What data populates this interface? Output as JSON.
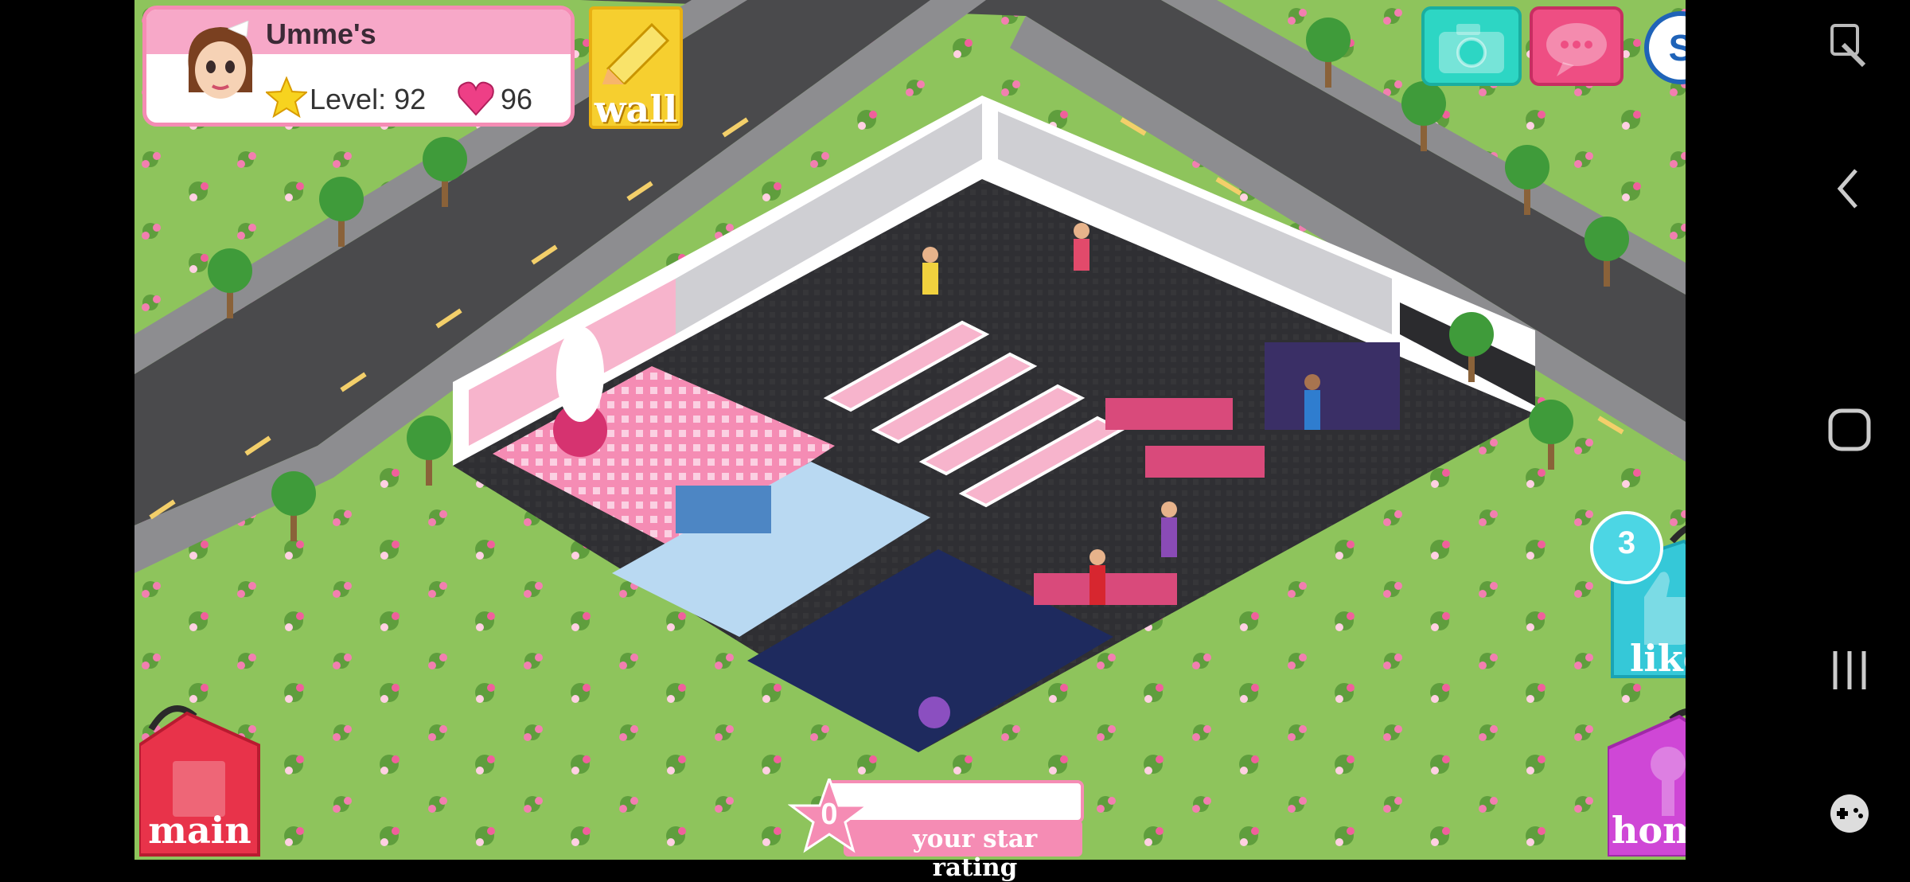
{
  "profile": {
    "name": "Umme's",
    "level_label": "Level: 92",
    "hearts": "96"
  },
  "buttons": {
    "wall": "wall",
    "like": "like",
    "like_count": "3",
    "main": "main",
    "home": "home",
    "camera_icon": "camera-icon",
    "chat_icon": "chat-bubble-icon",
    "s_icon": "social-s-icon"
  },
  "star_rating": {
    "value": "0",
    "label": "your star rating"
  },
  "system_nav": [
    "screenshot-edit-icon",
    "back-icon",
    "home-square-icon",
    "recents-icon",
    "game-controller-icon"
  ],
  "colors": {
    "grass": "#8ec45c",
    "road": "#4a4a4c",
    "floor_dark": "#2d2d30",
    "pink": "#f58cb4",
    "teal": "#2dd6c4",
    "gold": "#f6cf2f"
  }
}
